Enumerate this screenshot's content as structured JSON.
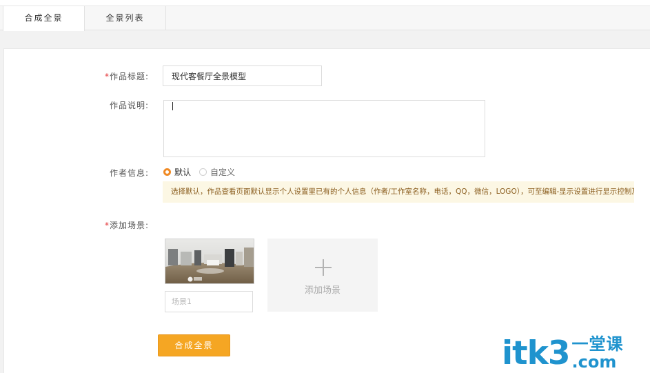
{
  "tabs": [
    {
      "label": "合成全景",
      "active": true
    },
    {
      "label": "全景列表",
      "active": false
    }
  ],
  "form": {
    "required_mark": "*",
    "title_label": "作品标题:",
    "title_value": "现代客餐厅全景模型",
    "desc_label": "作品说明:",
    "desc_value": "",
    "author_label": "作者信息:",
    "author_options": [
      {
        "label": "默认",
        "selected": true
      },
      {
        "label": "自定义",
        "selected": false
      }
    ],
    "author_notice": "选择默认，作品查看页面默认显示个人设置里已有的个人信息（作者/工作室名称，电话，QQ，微信，LOGO），可至编辑-显示设置进行显示控制及二次编辑",
    "scenes_label": "添加场景:",
    "scenes": [
      {
        "name": "",
        "placeholder": "场景1"
      }
    ],
    "add_scene_label": "添加场景",
    "submit_label": "合成全景"
  },
  "watermark": {
    "main": "itk3",
    "cn": "一堂课",
    "com": ".com"
  },
  "colors": {
    "accent": "#f5a623",
    "radio_on": "#f08a24",
    "required": "#e4393c",
    "notice_bg": "#fcf7e4",
    "watermark": "#1f93ce"
  }
}
